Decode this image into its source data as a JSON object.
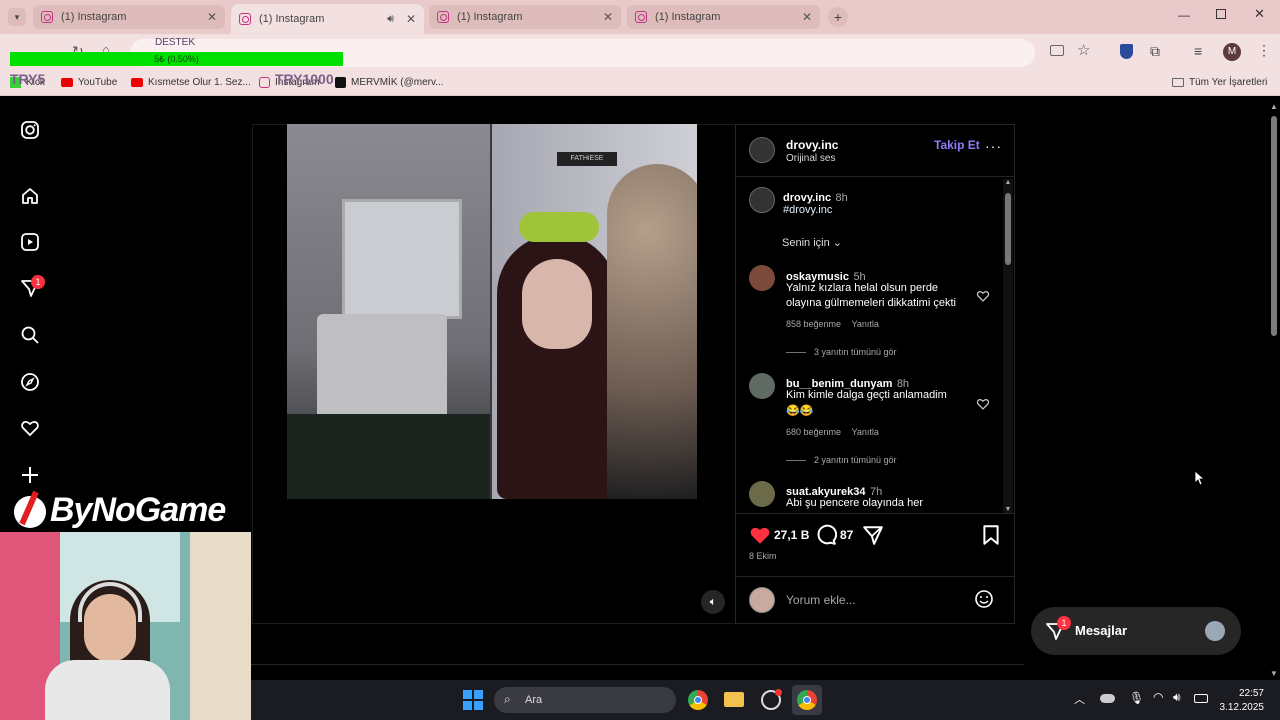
{
  "browser": {
    "tabs": [
      {
        "title": "(1) Instagram",
        "active": false
      },
      {
        "title": "(1) Instagram",
        "active": true
      },
      {
        "title": "(1) Instagram",
        "active": false
      },
      {
        "title": "(1) Instagram",
        "active": false
      }
    ],
    "new_tab": "+",
    "overlay": {
      "destek": "DESTEK",
      "progress_text": "5₺ (0.50%)",
      "left_label": "TRY5",
      "right_label": "TRY1000"
    },
    "profile_initial": "M",
    "bookmarks": [
      {
        "label": "Kick"
      },
      {
        "label": "YouTube"
      },
      {
        "label": "Kısmetse Olur 1. Sez..."
      },
      {
        "label": "Instagram"
      },
      {
        "label": "MERVMİK (@merv..."
      }
    ],
    "all_bookmarks": "Tüm Yer İşaretleri"
  },
  "instagram": {
    "notification_count": "1",
    "post": {
      "author": "drovy.inc",
      "audio": "Orijinal ses",
      "follow_label": "Takip Et",
      "caption_author": "drovy.inc",
      "caption_time": "8h",
      "caption_tag": "#drovy.inc",
      "sort_label": "Senin için",
      "comments": [
        {
          "user": "oskaymusic",
          "time": "5h",
          "text": "Yalnız kızlara helal olsun perde olayına gülmemeleri dikkatimi çekti",
          "likes": "858 beğenme",
          "reply": "Yanıtla",
          "view_replies": "3 yanıtın tümünü gör"
        },
        {
          "user": "bu__benim_dunyam",
          "time": "8h",
          "text": "Kim kimle dalga geçti anlamadim",
          "emoji": "😂😂",
          "likes": "680 beğenme",
          "reply": "Yanıtla",
          "view_replies": "2 yanıtın tümünü gör"
        },
        {
          "user": "suat.akyurek34",
          "time": "7h",
          "text": "Abi şu pencere olayında her"
        }
      ],
      "like_count": "27,1 B",
      "comment_count": "87",
      "date": "8 Ekim",
      "comment_placeholder": "Yorum ekle...",
      "video_sign": "FATHiESE"
    },
    "messages": {
      "label": "Mesajlar",
      "badge": "1"
    }
  },
  "overlay_logo": {
    "text": "ByNoGame"
  },
  "taskbar": {
    "search_placeholder": "Ara",
    "time": "22:57",
    "date": "3.12.2025"
  },
  "colors": {
    "accent": "#0095f6",
    "like": "#ff3040",
    "follow": "#8f7cf7"
  }
}
